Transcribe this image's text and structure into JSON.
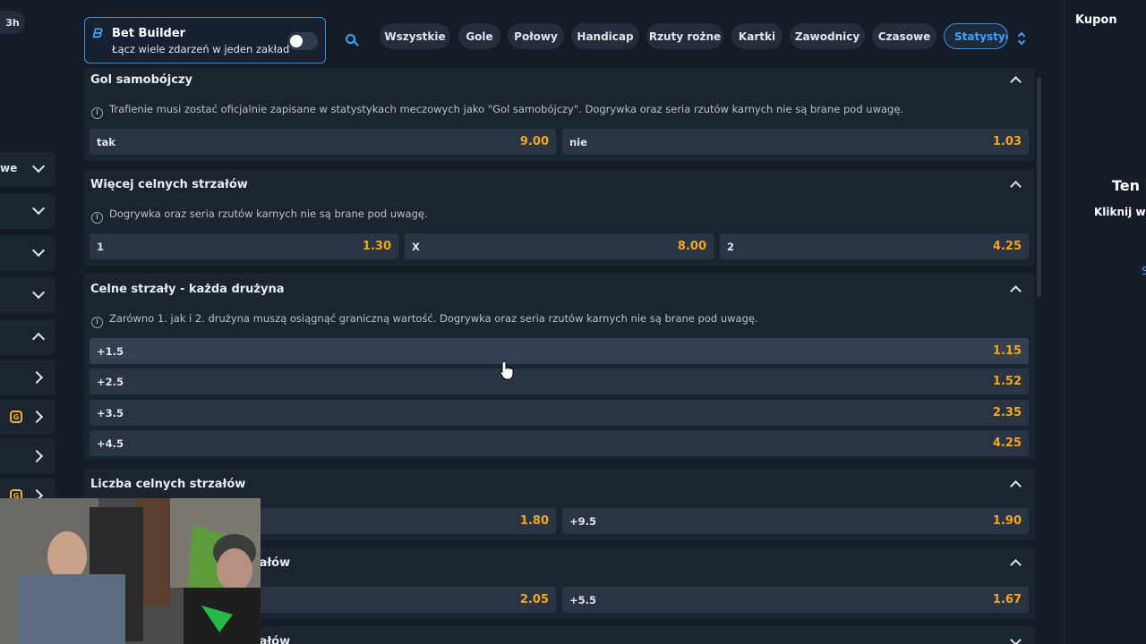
{
  "left": {
    "time_pill": "3h",
    "row1_text": "we"
  },
  "betbuilder": {
    "title": "Bet Builder",
    "subtitle": "Łącz wiele zdarzeń w jeden zakład",
    "toggle_on": false
  },
  "tabs": [
    "Wszystkie",
    "Gole",
    "Połowy",
    "Handicap",
    "Rzuty rożne",
    "Kartki",
    "Zawodnicy",
    "Czasowe",
    "Statystyc"
  ],
  "active_tab_index": 8,
  "markets": [
    {
      "title": "Gol samobójczy",
      "info": "Trafienie musi zostać oficjalnie zapisane w statystykach meczowych jako \"Gol samobójczy\". Dogrywka oraz seria rzutów karnych nie są brane pod uwagę.",
      "selections": [
        {
          "label": "tak",
          "odds": "9.00"
        },
        {
          "label": "nie",
          "odds": "1.03"
        }
      ]
    },
    {
      "title": "Więcej celnych strzałów",
      "info": "Dogrywka oraz seria rzutów karnych nie są brane pod uwagę.",
      "selections": [
        {
          "label": "1",
          "odds": "1.30"
        },
        {
          "label": "X",
          "odds": "8.00"
        },
        {
          "label": "2",
          "odds": "4.25"
        }
      ]
    },
    {
      "title": "Celne strzały - każda drużyna",
      "info": "Zarówno 1. jak i 2. drużyna muszą osiągnąć graniczną wartość. Dogrywka oraz seria rzutów karnych nie są brane pod uwagę.",
      "selections": [
        {
          "label": "+1.5",
          "odds": "1.15"
        },
        {
          "label": "+2.5",
          "odds": "1.52"
        },
        {
          "label": "+3.5",
          "odds": "2.35"
        },
        {
          "label": "+4.5",
          "odds": "4.25"
        }
      ]
    },
    {
      "title": "Liczba celnych strzałów",
      "selections": [
        {
          "label": "",
          "odds": "1.80"
        },
        {
          "label": "+9.5",
          "odds": "1.90"
        }
      ]
    },
    {
      "title": "załów",
      "selections": [
        {
          "label": "",
          "odds": "2.05"
        },
        {
          "label": "+5.5",
          "odds": "1.67"
        }
      ]
    },
    {
      "title": "załów"
    }
  ],
  "coupon": {
    "title": "Kupon",
    "empty_title": "Ten k",
    "empty_hint": "Kliknij w k",
    "link": "S"
  },
  "colors": {
    "accent": "#3fa3ff",
    "odds": "#f2a81d",
    "background": "#141c28",
    "panel": "#1b2431",
    "selection": "#2a3443"
  }
}
